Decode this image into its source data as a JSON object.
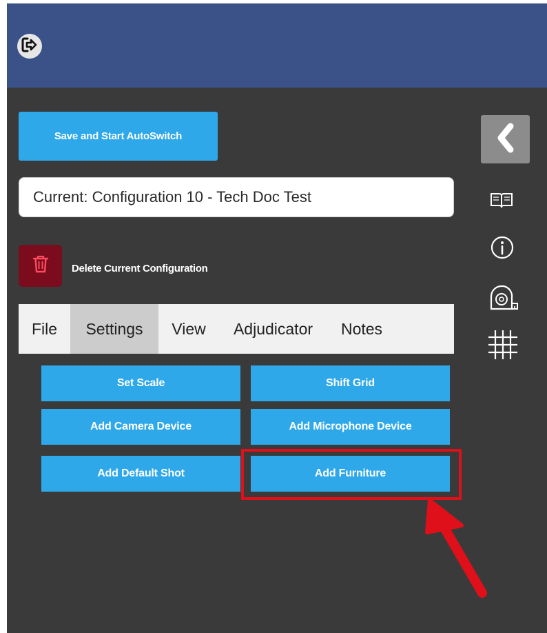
{
  "header": {
    "logout_icon": "logout-arrow-icon"
  },
  "actions": {
    "save_label": "Save and Start AutoSwitch",
    "delete_label": "Delete Current Configuration"
  },
  "config": {
    "current": "Current: Configuration 10 - Tech Doc Test"
  },
  "tabs": [
    {
      "label": "File",
      "active": false
    },
    {
      "label": "Settings",
      "active": true
    },
    {
      "label": "View",
      "active": false
    },
    {
      "label": "Adjudicator",
      "active": false
    },
    {
      "label": "Notes",
      "active": false
    }
  ],
  "settings_buttons": [
    {
      "label": "Set Scale"
    },
    {
      "label": "Shift Grid"
    },
    {
      "label": "Add Camera Device"
    },
    {
      "label": "Add Microphone Device"
    },
    {
      "label": "Add Default Shot"
    },
    {
      "label": "Add Furniture",
      "highlighted": true
    }
  ],
  "sidebar": {
    "icons": [
      "collapse-chevron-icon",
      "book-icon",
      "info-icon",
      "tape-measure-icon",
      "grid-icon"
    ]
  },
  "colors": {
    "header": "#3b5289",
    "panel": "#3a3a3a",
    "accent": "#2fa8ea",
    "danger": "#7a0c1e",
    "highlight": "#e0101a"
  }
}
